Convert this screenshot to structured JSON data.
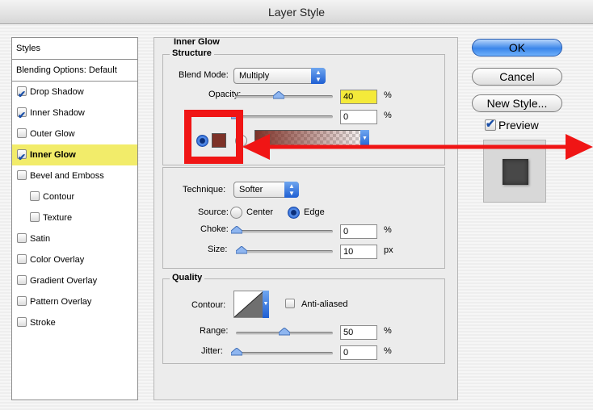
{
  "window": {
    "title": "Layer Style"
  },
  "styles_panel": {
    "header": "Styles",
    "blending_options": "Blending Options: Default",
    "items": [
      {
        "label": "Drop Shadow",
        "checked": true,
        "indent": false,
        "selected": false
      },
      {
        "label": "Inner Shadow",
        "checked": true,
        "indent": false,
        "selected": false
      },
      {
        "label": "Outer Glow",
        "checked": false,
        "indent": false,
        "selected": false
      },
      {
        "label": "Inner Glow",
        "checked": true,
        "indent": false,
        "selected": true
      },
      {
        "label": "Bevel and Emboss",
        "checked": false,
        "indent": false,
        "selected": false
      },
      {
        "label": "Contour",
        "checked": false,
        "indent": true,
        "selected": false
      },
      {
        "label": "Texture",
        "checked": false,
        "indent": true,
        "selected": false
      },
      {
        "label": "Satin",
        "checked": false,
        "indent": false,
        "selected": false
      },
      {
        "label": "Color Overlay",
        "checked": false,
        "indent": false,
        "selected": false
      },
      {
        "label": "Gradient Overlay",
        "checked": false,
        "indent": false,
        "selected": false
      },
      {
        "label": "Pattern Overlay",
        "checked": false,
        "indent": false,
        "selected": false
      },
      {
        "label": "Stroke",
        "checked": false,
        "indent": false,
        "selected": false
      }
    ]
  },
  "inner_glow": {
    "title": "Inner Glow",
    "structure": {
      "title": "Structure",
      "blend_mode_label": "Blend Mode:",
      "blend_mode_value": "Multiply",
      "opacity_label": "Opacity:",
      "opacity_value": "40",
      "opacity_unit": "%",
      "noise_value": "0",
      "noise_unit": "%",
      "glow_color": "#7d3228"
    },
    "elements": {
      "technique_label": "Technique:",
      "technique_value": "Softer",
      "source_label": "Source:",
      "source_center": "Center",
      "source_edge": "Edge",
      "choke_label": "Choke:",
      "choke_value": "0",
      "choke_unit": "%",
      "size_label": "Size:",
      "size_value": "10",
      "size_unit": "px"
    },
    "quality": {
      "title": "Quality",
      "contour_label": "Contour:",
      "anti_aliased_label": "Anti-aliased",
      "range_label": "Range:",
      "range_value": "50",
      "range_unit": "%",
      "jitter_label": "Jitter:",
      "jitter_value": "0",
      "jitter_unit": "%"
    }
  },
  "buttons": {
    "ok": "OK",
    "cancel": "Cancel",
    "new_style": "New Style...",
    "preview": "Preview"
  },
  "colors": {
    "selected_row": "#f2ec6a",
    "accent_blue": "#3b86ea",
    "annotation_red": "#f01515"
  }
}
